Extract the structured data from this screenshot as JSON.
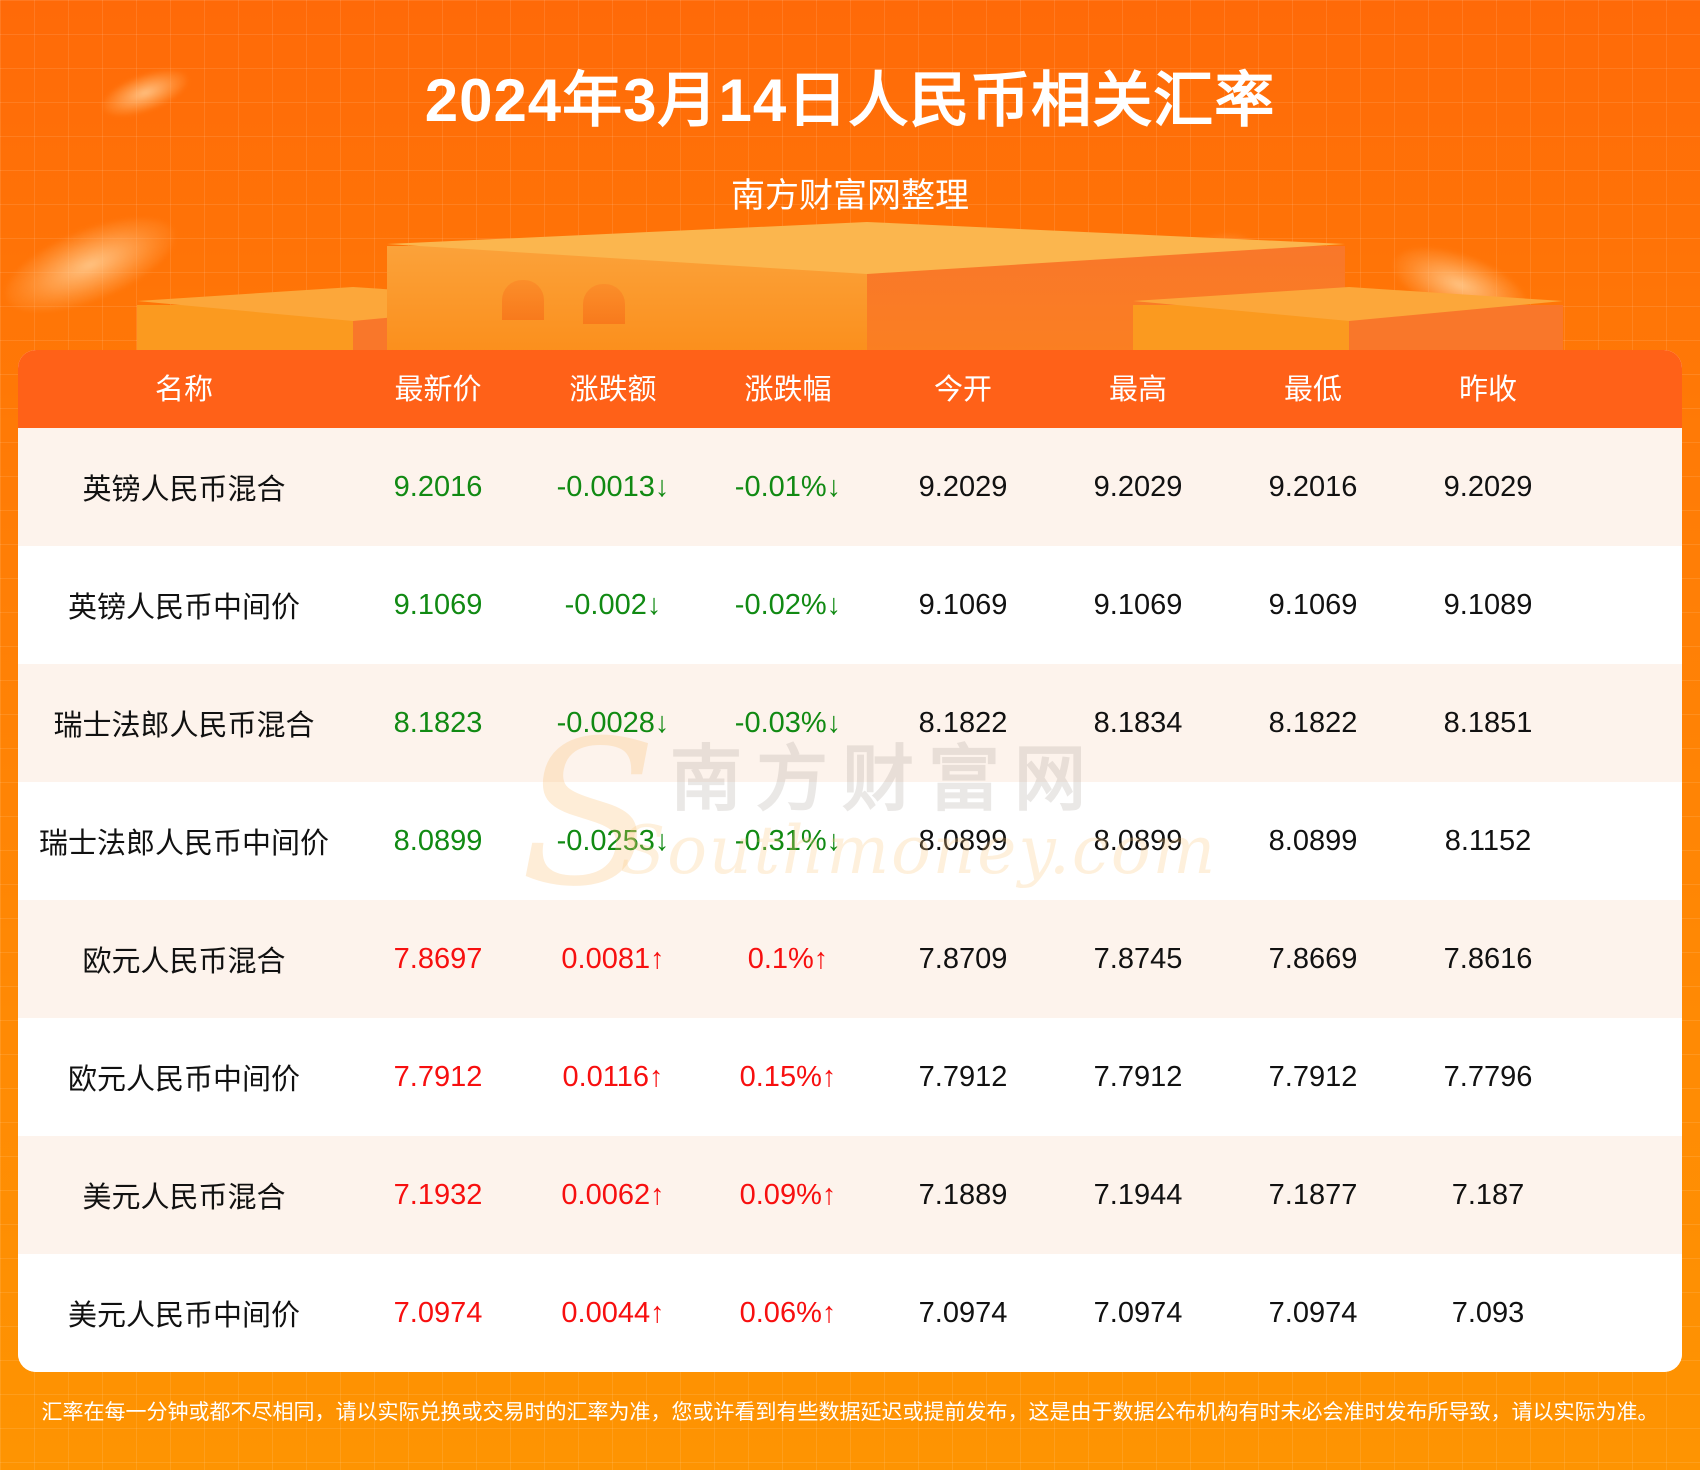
{
  "header": {
    "title": "2024年3月14日人民币相关汇率",
    "subtitle": "南方财富网整理"
  },
  "colors": {
    "header_bar": "#ff6118",
    "up": "#f70f0f",
    "down": "#118a13",
    "row_alt": "#fdf3ec"
  },
  "table": {
    "columns": [
      "名称",
      "最新价",
      "涨跌额",
      "涨跌幅",
      "今开",
      "最高",
      "最低",
      "昨收"
    ],
    "rows": [
      {
        "name": "英镑人民币混合",
        "latest": "9.2016",
        "change": "-0.0013↓",
        "change_pct": "-0.01%↓",
        "open": "9.2029",
        "high": "9.2029",
        "low": "9.2016",
        "prev_close": "9.2029",
        "trend": "down"
      },
      {
        "name": "英镑人民币中间价",
        "latest": "9.1069",
        "change": "-0.002↓",
        "change_pct": "-0.02%↓",
        "open": "9.1069",
        "high": "9.1069",
        "low": "9.1069",
        "prev_close": "9.1089",
        "trend": "down"
      },
      {
        "name": "瑞士法郎人民币混合",
        "latest": "8.1823",
        "change": "-0.0028↓",
        "change_pct": "-0.03%↓",
        "open": "8.1822",
        "high": "8.1834",
        "low": "8.1822",
        "prev_close": "8.1851",
        "trend": "down"
      },
      {
        "name": "瑞士法郎人民币中间价",
        "latest": "8.0899",
        "change": "-0.0253↓",
        "change_pct": "-0.31%↓",
        "open": "8.0899",
        "high": "8.0899",
        "low": "8.0899",
        "prev_close": "8.1152",
        "trend": "down"
      },
      {
        "name": "欧元人民币混合",
        "latest": "7.8697",
        "change": "0.0081↑",
        "change_pct": "0.1%↑",
        "open": "7.8709",
        "high": "7.8745",
        "low": "7.8669",
        "prev_close": "7.8616",
        "trend": "up"
      },
      {
        "name": "欧元人民币中间价",
        "latest": "7.7912",
        "change": "0.0116↑",
        "change_pct": "0.15%↑",
        "open": "7.7912",
        "high": "7.7912",
        "low": "7.7912",
        "prev_close": "7.7796",
        "trend": "up"
      },
      {
        "name": "美元人民币混合",
        "latest": "7.1932",
        "change": "0.0062↑",
        "change_pct": "0.09%↑",
        "open": "7.1889",
        "high": "7.1944",
        "low": "7.1877",
        "prev_close": "7.187",
        "trend": "up"
      },
      {
        "name": "美元人民币中间价",
        "latest": "7.0974",
        "change": "0.0044↑",
        "change_pct": "0.06%↑",
        "open": "7.0974",
        "high": "7.0974",
        "low": "7.0974",
        "prev_close": "7.093",
        "trend": "up"
      }
    ]
  },
  "watermark": {
    "cn": "南方财富网",
    "en": "Southmoney.com",
    "logo_letter": "S"
  },
  "footer": {
    "disclaimer": "汇率在每一分钟或都不尽相同，请以实际兑换或交易时的汇率为准，您或许看到有些数据延迟或提前发布，这是由于数据公布机构有时未必会准时发布所导致，请以实际为准。"
  }
}
